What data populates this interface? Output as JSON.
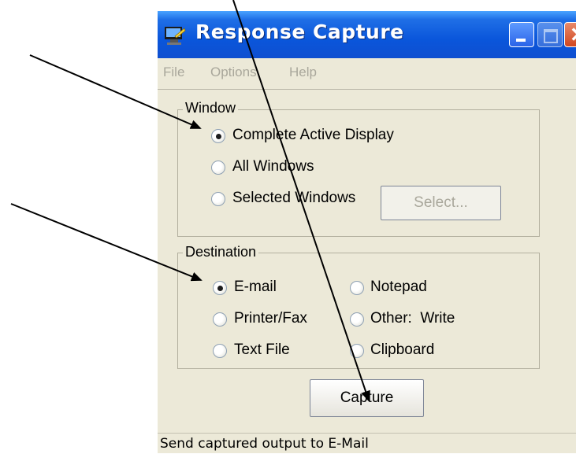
{
  "window": {
    "title": "Response Capture",
    "title_bar_color": "#0a56db",
    "buttons": [
      "minimize-icon",
      "maximize-icon",
      "close-icon"
    ],
    "close_glyph": "✕"
  },
  "menu": [
    "File",
    "Options",
    "Help"
  ],
  "groups": {
    "window": {
      "label": "Window",
      "options": [
        {
          "label": "Complete Active Display",
          "checked": true
        },
        {
          "label": "All Windows",
          "checked": false
        },
        {
          "label": "Selected Windows",
          "checked": false
        }
      ],
      "select_button": "Select..."
    },
    "destination": {
      "label": "Destination",
      "options": [
        {
          "label": "E-mail",
          "checked": true
        },
        {
          "label": "Notepad",
          "checked": false
        },
        {
          "label": "Printer/Fax",
          "checked": false
        },
        {
          "label": "Other:  Write",
          "checked": false
        },
        {
          "label": "Text File",
          "checked": false
        },
        {
          "label": "Clipboard",
          "checked": false
        }
      ]
    }
  },
  "capture_button": "Capture",
  "status_bar": "Send captured output to E-Mail",
  "annotations": [
    "arrow",
    "arrow",
    "arrow"
  ]
}
